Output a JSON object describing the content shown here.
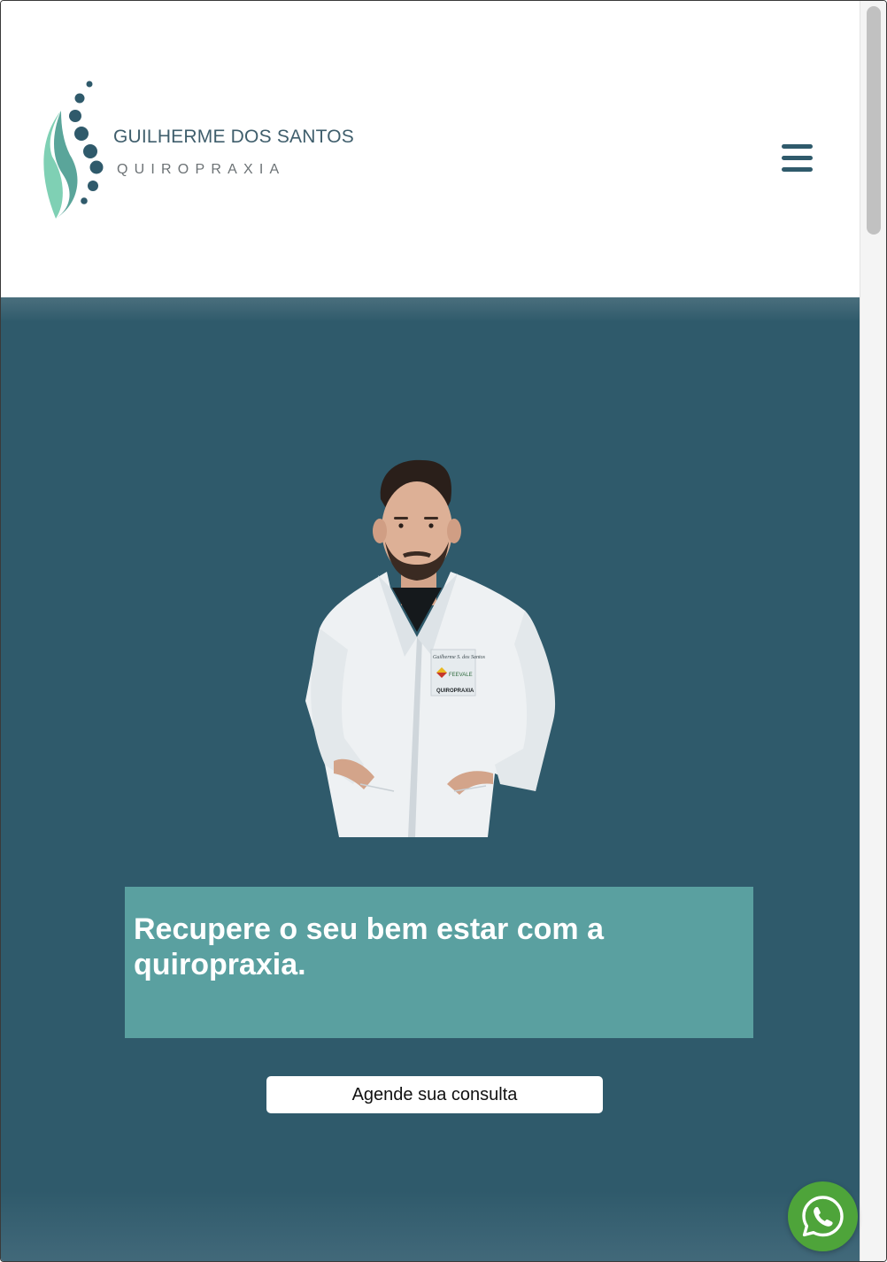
{
  "header": {
    "brand_name": "GUILHERME DOS SANTOS",
    "brand_sub": "QUIROPRAXIA",
    "menu_icon": "hamburger-menu-icon"
  },
  "hero": {
    "headline": "Recupere o seu bem estar com a quiropraxia.",
    "cta_label": "Agende sua consulta",
    "photo_description": "chiropractor-portrait",
    "coat_badge": {
      "line1": "Guilherme S. dos Santos",
      "line2": "FEEVALE",
      "line3": "QUIROPRAXIA"
    }
  },
  "floating": {
    "whatsapp_icon": "whatsapp-icon"
  },
  "colors": {
    "primary": "#2f5a6b",
    "accent": "#5aa0a0",
    "whatsapp": "#4ea43a",
    "logo_mint": "#7fd0b4",
    "logo_teal": "#5aa59a"
  }
}
